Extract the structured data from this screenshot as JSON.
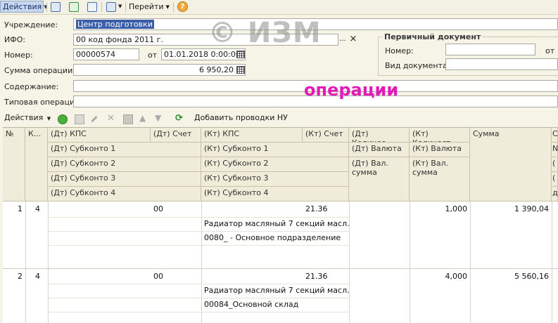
{
  "toolbar": {
    "actions_label": "Действия",
    "goto_label": "Перейти",
    "help_label": "?"
  },
  "form": {
    "institution_label": "Учреждение:",
    "institution_value": "Центр подготовки",
    "ifo_label": "ИФО:",
    "ifo_value": "00 код фонда 2011 г.",
    "number_label": "Номер:",
    "number_value": "00000574",
    "from_label": "от",
    "date_value": "01.01.2018  0:00:00",
    "sum_label": "Сумма операции:",
    "sum_value": "6 950,20",
    "content_label": "Содержание:",
    "typical_label": "Типовая операция:",
    "ellipsis": "...",
    "clear": "×"
  },
  "primary_doc": {
    "title": "Первичный документ",
    "number_label": "Номер:",
    "from_label": "от",
    "doctype_label": "Вид документа:"
  },
  "overlay_text": "операции",
  "watermark_text": "© ИЗМ",
  "table_toolbar": {
    "actions_label": "Действия",
    "add_ny_label": "Добавить проводки НУ"
  },
  "grid": {
    "headers": {
      "num": "№",
      "k": "К...",
      "dt_kps": "(Дт) КПС",
      "dt_account": "(Дт) Счет",
      "kt_kps": "(Кт) КПС",
      "kt_account": "(Кт) Счет",
      "dt_qty": "(Дт) Количес...",
      "kt_qty": "(Кт) Количест...",
      "sum": "Сумма",
      "extra": "С",
      "dt_sub1": "(Дт) Субконто 1",
      "kt_sub1": "(Кт) Субконто 1",
      "dt_cur": "(Дт) Валюта",
      "kt_cur": "(Кт) Валюта",
      "extra2": "N",
      "dt_sub2": "(Дт) Субконто 2",
      "kt_sub2": "(Кт) Субконто 2",
      "dt_cursum": "(Дт) Вал. сумма",
      "kt_cursum": "(Кт) Вал. сумма",
      "extra3": "(",
      "dt_sub3": "(Дт) Субконто 3",
      "kt_sub3": "(Кт) Субконто 3",
      "extra4": "(",
      "dt_sub4": "(Дт) Субконто 4",
      "kt_sub4": "(Кт) Субконто 4",
      "extra5": "д"
    },
    "rows": [
      {
        "num": "1",
        "k": "4",
        "dt_account": "00",
        "kt_account": "21.36",
        "kt_qty": "1,000",
        "sum": "1 390,04",
        "kt_sub1": "Радиатор масляный 7 секций масл.",
        "kt_sub2": "0080_ - Основное подразделение"
      },
      {
        "num": "2",
        "k": "4",
        "dt_account": "00",
        "kt_account": "21.36",
        "kt_qty": "4,000",
        "sum": "5 560,16",
        "kt_sub1": "Радиатор масляный 7 секций масл.",
        "kt_sub2": "00084_Основной склад"
      }
    ]
  }
}
